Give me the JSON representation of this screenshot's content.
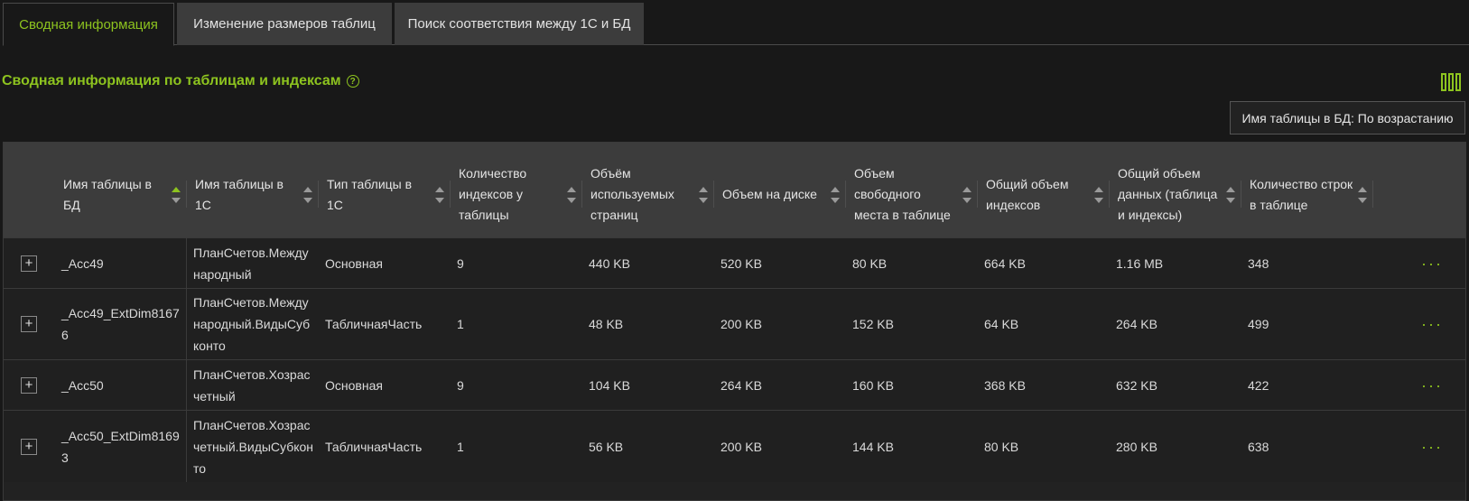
{
  "tabs": [
    {
      "label": "Сводная информация",
      "active": true
    },
    {
      "label": "Изменение размеров таблиц",
      "active": false
    },
    {
      "label": "Поиск соответствия между 1С и БД",
      "active": false
    }
  ],
  "heading": {
    "title": "Сводная информация по таблицам и индексам",
    "help_icon": "?"
  },
  "sort_chip": "Имя таблицы в БД: По возрастанию",
  "table": {
    "columns": [
      {
        "label": "Имя таблицы в БД",
        "sorted": "asc"
      },
      {
        "label": "Имя таблицы в 1С"
      },
      {
        "label": "Тип таблицы в 1С"
      },
      {
        "label": "Количество индексов у таблицы"
      },
      {
        "label": "Объём используемых страниц"
      },
      {
        "label": "Объем на диске"
      },
      {
        "label": "Объем свободного места в таблице"
      },
      {
        "label": "Общий объем индексов"
      },
      {
        "label": "Общий объем данных (таблица и индексы)"
      },
      {
        "label": "Количество строк в таблице"
      }
    ],
    "rows": [
      {
        "db": "_Acc49",
        "c1": "ПланСчетов.Международный",
        "type": "Основная",
        "idx": "9",
        "pages": "440 KB",
        "disk": "520 KB",
        "free": "80 KB",
        "indexes": "664 KB",
        "total": "1.16 MB",
        "rows": "348"
      },
      {
        "db": "_Acc49_ExtDim81676",
        "c1": "ПланСчетов.Международный.ВидыСубконто",
        "type": "ТабличнаяЧасть",
        "idx": "1",
        "pages": "48 KB",
        "disk": "200 KB",
        "free": "152 KB",
        "indexes": "64 KB",
        "total": "264 KB",
        "rows": "499"
      },
      {
        "db": "_Acc50",
        "c1": "ПланСчетов.Хозрасчетный",
        "type": "Основная",
        "idx": "9",
        "pages": "104 KB",
        "disk": "264 KB",
        "free": "160 KB",
        "indexes": "368 KB",
        "total": "632 KB",
        "rows": "422"
      },
      {
        "db": "_Acc50_ExtDim81693",
        "c1": "ПланСчетов.Хозрасчетный.ВидыСубконто",
        "type": "ТабличнаяЧасть",
        "idx": "1",
        "pages": "56 KB",
        "disk": "200 KB",
        "free": "144 KB",
        "indexes": "80 KB",
        "total": "280 KB",
        "rows": "638"
      }
    ],
    "row_action_icon": "···",
    "expand_icon": "+"
  },
  "colors": {
    "accent": "#8dc31f",
    "background": "#181818",
    "header_bg": "#3c3c3c"
  },
  "icons": [
    "help-circle-icon",
    "columns-icon",
    "sort-arrows-icon",
    "expand-plus-icon",
    "more-dots-icon"
  ]
}
